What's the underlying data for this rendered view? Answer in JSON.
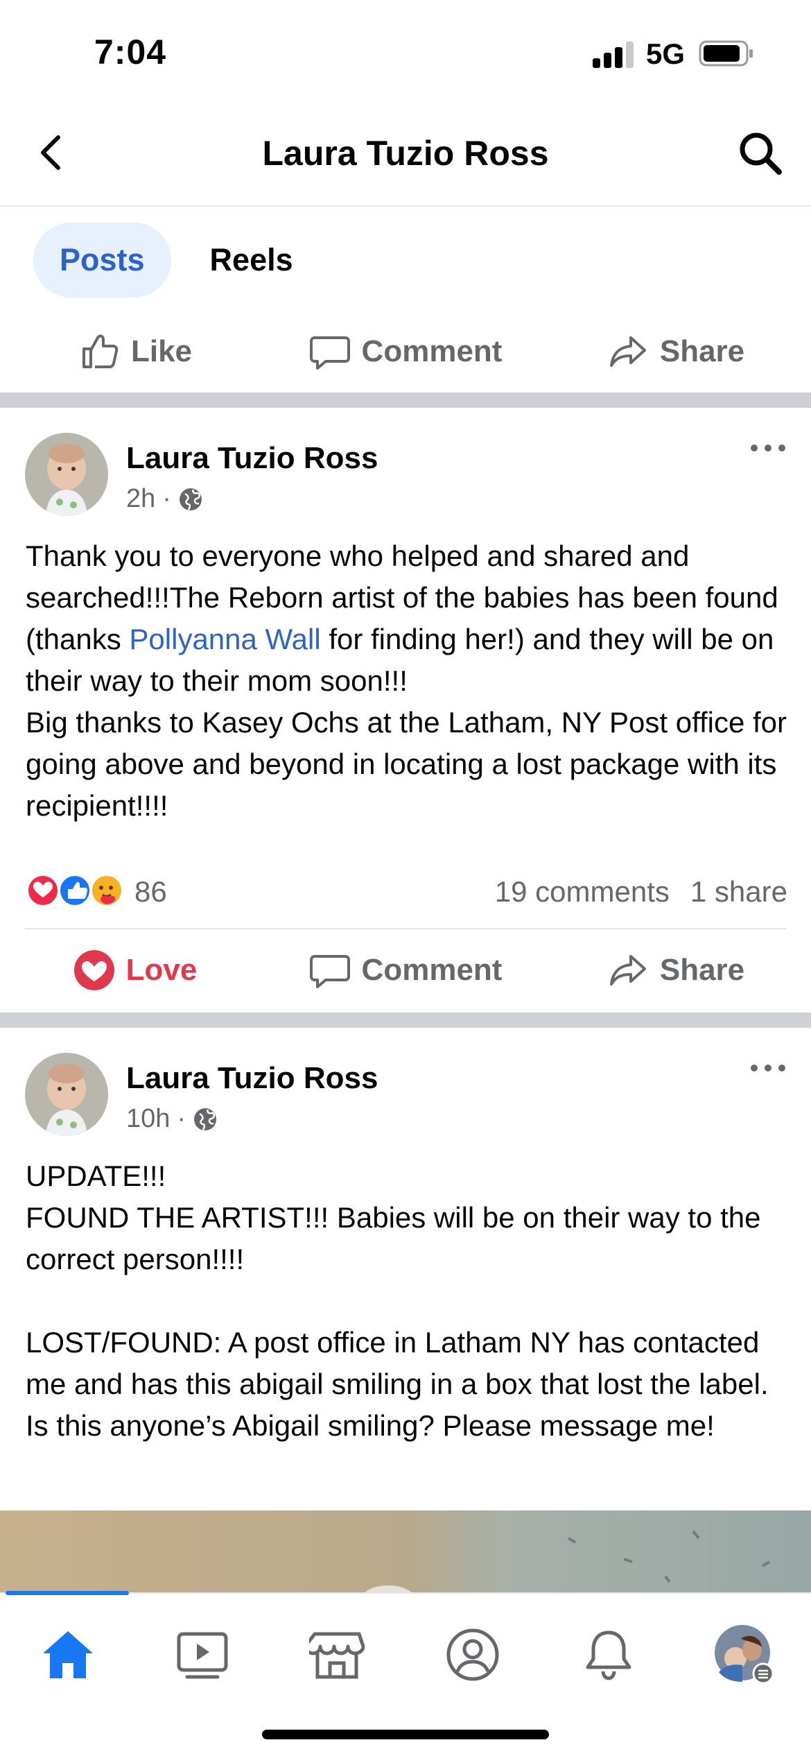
{
  "status_bar": {
    "time": "7:04",
    "network": "5G"
  },
  "header": {
    "title": "Laura Tuzio Ross"
  },
  "tabs": [
    {
      "label": "Posts",
      "active": true
    },
    {
      "label": "Reels",
      "active": false
    }
  ],
  "top_actions": {
    "like": "Like",
    "comment": "Comment",
    "share": "Share"
  },
  "posts": [
    {
      "author": "Laura Tuzio Ross",
      "time": "2h",
      "dot": "·",
      "body": {
        "line1_pre": "Thank you to everyone who helped and shared and searched!!!The Reborn artist of the babies has been found (thanks ",
        "mention": "Pollyanna Wall",
        "line1_post": " for finding her!) and they will be on their way to their mom soon!!!",
        "line2": "Big thanks to Kasey Ochs at the Latham, NY Post office for going above and beyond in locating a lost package with its recipient!!!!"
      },
      "reaction_count": "86",
      "comments": "19 comments",
      "shares": "1 share",
      "actions": {
        "love": "Love",
        "comment": "Comment",
        "share": "Share"
      }
    },
    {
      "author": "Laura Tuzio Ross",
      "time": "10h",
      "dot": "·",
      "body": {
        "p1": "UPDATE!!!",
        "p2": "FOUND THE ARTIST!!! Babies will be on their way to the correct person!!!!",
        "p3": "LOST/FOUND: A post office in Latham NY has contacted me and has this abigail smiling in a box that lost the label. Is this anyone’s Abigail smiling? Please message me!"
      }
    }
  ],
  "colors": {
    "accent": "#1877f2",
    "love": "#e0384c",
    "link": "#2d62c8",
    "muted": "#65676b"
  },
  "bottom_nav": [
    "home-icon",
    "video-icon",
    "marketplace-icon",
    "profile-icon",
    "notifications-icon",
    "menu-avatar-icon"
  ]
}
